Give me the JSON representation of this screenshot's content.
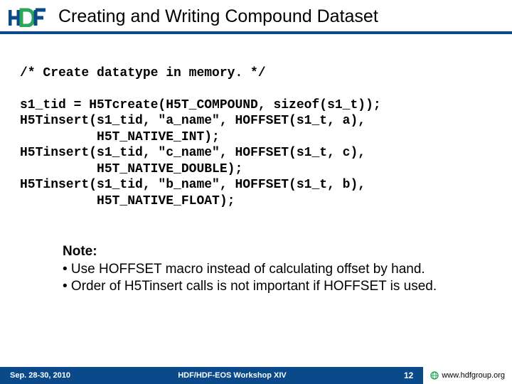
{
  "header": {
    "title": "Creating and Writing Compound Dataset"
  },
  "code": {
    "comment": "/* Create datatype in memory. */",
    "lines": "s1_tid = H5Tcreate(H5T_COMPOUND, sizeof(s1_t));\nH5Tinsert(s1_tid, \"a_name\", HOFFSET(s1_t, a),\n          H5T_NATIVE_INT);\nH5Tinsert(s1_tid, \"c_name\", HOFFSET(s1_t, c),\n          H5T_NATIVE_DOUBLE);\nH5Tinsert(s1_tid, \"b_name\", HOFFSET(s1_t, b),\n          H5T_NATIVE_FLOAT);"
  },
  "notes": {
    "heading": "Note:",
    "bullet1": "• Use HOFFSET macro instead of calculating offset by hand.",
    "bullet2": "• Order of H5Tinsert calls is not important if HOFFSET is used."
  },
  "footer": {
    "date": "Sep. 28-30, 2010",
    "center": "HDF/HDF-EOS Workshop XIV",
    "page": "12",
    "site": "www.hdfgroup.org"
  }
}
